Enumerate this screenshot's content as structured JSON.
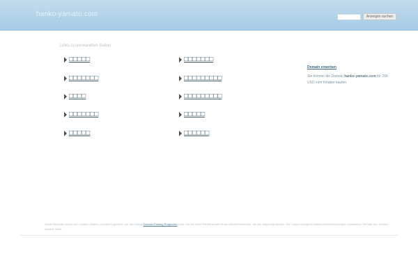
{
  "header": {
    "site_title": "hanko-yamato.com",
    "search_value": "",
    "search_button_label": "Anzeigen suchen"
  },
  "links": {
    "heading": "Links zu verwandten Seiten",
    "items": [
      {
        "label": "□□□□□"
      },
      {
        "label": "□□□□□□□"
      },
      {
        "label": "□□□□□□□"
      },
      {
        "label": "□□□□□□□□□"
      },
      {
        "label": "□□□□"
      },
      {
        "label": "□□□□□□□□□"
      },
      {
        "label": "□□□□□□□"
      },
      {
        "label": "□□□□□"
      },
      {
        "label": "□□□□□"
      },
      {
        "label": "□□□□□□"
      }
    ]
  },
  "sidebar": {
    "domain_link": "Domain erwerben",
    "text_before": "Sie können die Domain",
    "domain": "hanko-yamato.com",
    "text_after": "für 299 USD vom Inhaber kaufen."
  },
  "footer": {
    "text_before": "Diese Webseite wurde vom Domain Inhaber (Kunde/in) gewählt, der den Dienst",
    "policy_link": "Domain Parking Programm",
    "text_after": "nutzt. Sie hat keine Partnerschaft mit den Werbetreibenden, die hier angezeigt werden. Bei Fragen bezüglich Markenrechtsverletzungen kontaktieren Sie bitte den Domain Inhaber direkt."
  }
}
